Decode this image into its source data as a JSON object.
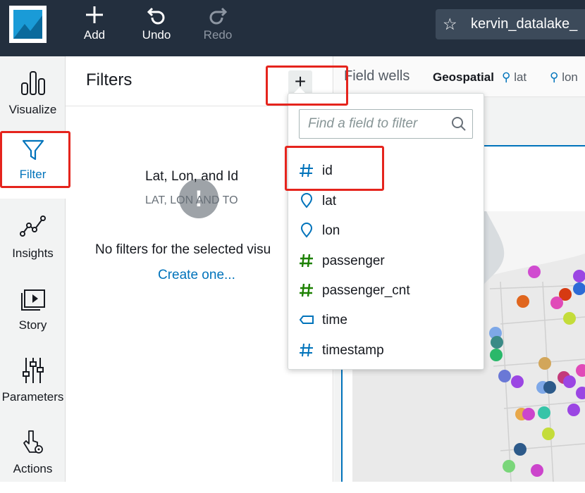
{
  "topbar": {
    "add_label": "Add",
    "undo_label": "Undo",
    "redo_label": "Redo",
    "analysis_title": "kervin_datalake_"
  },
  "nav": {
    "items": [
      {
        "label": "Visualize",
        "icon": "bar-chart-icon"
      },
      {
        "label": "Filter",
        "icon": "filter-icon"
      },
      {
        "label": "Insights",
        "icon": "insights-icon"
      },
      {
        "label": "Story",
        "icon": "story-icon"
      },
      {
        "label": "Parameters",
        "icon": "sliders-icon"
      },
      {
        "label": "Actions",
        "icon": "pointer-gear-icon"
      }
    ],
    "active": "Filter"
  },
  "filters": {
    "title": "Filters",
    "empty_message": "No filters for the selected visu",
    "create_link": "Create one..."
  },
  "field_wells": {
    "label": "Field wells",
    "geospatial_label": "Geospatial",
    "lat_label": "lat",
    "lon_label": "lon"
  },
  "visual": {
    "title": "Lat, Lon, and Id",
    "subtitle": "LAT, LON AND TO"
  },
  "dropdown": {
    "search_placeholder": "Find a field to filter",
    "fields": [
      {
        "name": "id",
        "type": "number"
      },
      {
        "name": "lat",
        "type": "geo"
      },
      {
        "name": "lon",
        "type": "geo"
      },
      {
        "name": "passenger",
        "type": "measure"
      },
      {
        "name": "passenger_cnt",
        "type": "measure"
      },
      {
        "name": "time",
        "type": "string"
      },
      {
        "name": "timestamp",
        "type": "number"
      }
    ]
  },
  "colors": {
    "topbar_bg": "#232f3e",
    "accent": "#0073bb",
    "highlight": "#e5241d",
    "measure_green": "#1d8102"
  }
}
